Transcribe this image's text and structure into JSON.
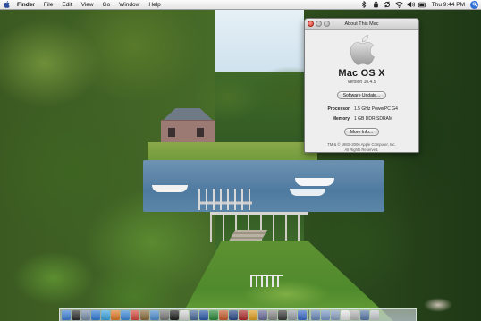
{
  "menubar": {
    "apple_symbol": "",
    "app_name": "Finder",
    "items": [
      "File",
      "Edit",
      "View",
      "Go",
      "Window",
      "Help"
    ],
    "status_icons": [
      "bluetooth-icon",
      "keychain-lock-icon",
      "sync-icon",
      "airport-wifi-icon",
      "volume-icon",
      "battery-icon"
    ],
    "clock": "Thu 9:44 PM"
  },
  "about_window": {
    "title": "About This Mac",
    "os_name": "Mac OS X",
    "version": "Version 10.4.5",
    "software_update_button": "Software Update...",
    "processor_label": "Processor",
    "processor_value": "1.5 GHz PowerPC G4",
    "memory_label": "Memory",
    "memory_value": "1 GB DDR SDRAM",
    "more_info_button": "More Info...",
    "legal_line1": "TM & © 1983–2006 Apple Computer, Inc.",
    "legal_line2": "All Rights Reserved."
  },
  "dock": {
    "items": [
      {
        "name": "finder-icon",
        "color": "#3d7fd8"
      },
      {
        "name": "dashboard-icon",
        "color": "#2b2b2b"
      },
      {
        "name": "mail-icon",
        "color": "#7a8fa8"
      },
      {
        "name": "safari-icon",
        "color": "#2f7bd6"
      },
      {
        "name": "ichat-icon",
        "color": "#3aa4e0"
      },
      {
        "name": "firefox-icon",
        "color": "#e07a22"
      },
      {
        "name": "itunes-icon",
        "color": "#3a8ad8"
      },
      {
        "name": "ical-icon",
        "color": "#d6473d"
      },
      {
        "name": "address-book-icon",
        "color": "#8a6a3a"
      },
      {
        "name": "iphoto-icon",
        "color": "#4f8fcf"
      },
      {
        "name": "system-preferences-icon",
        "color": "#7a7a7a"
      },
      {
        "name": "terminal-icon",
        "color": "#1f1f1f"
      },
      {
        "name": "textedit-icon",
        "color": "#d8d8d8"
      },
      {
        "name": "preview-icon",
        "color": "#4a6a9a"
      },
      {
        "name": "word-icon",
        "color": "#2a5aa8"
      },
      {
        "name": "excel-icon",
        "color": "#2a8a3a"
      },
      {
        "name": "powerpoint-icon",
        "color": "#c85a2a"
      },
      {
        "name": "photoshop-icon",
        "color": "#2a4a8a"
      },
      {
        "name": "acrobat-icon",
        "color": "#b02a2a"
      },
      {
        "name": "garageband-icon",
        "color": "#e0a020"
      },
      {
        "name": "imovie-icon",
        "color": "#6a6a9a"
      },
      {
        "name": "idvd-icon",
        "color": "#8a8a8a"
      },
      {
        "name": "activity-monitor-icon",
        "color": "#3a3a3a"
      },
      {
        "name": "disk-utility-icon",
        "color": "#9aa0a8"
      },
      {
        "name": "quicktime-icon",
        "color": "#3a6ac8"
      }
    ],
    "right_items": [
      {
        "name": "applications-folder-icon",
        "color": "#6a8ab8"
      },
      {
        "name": "documents-folder-icon",
        "color": "#7a9ac8"
      },
      {
        "name": "downloads-stack-icon",
        "color": "#8aa0c0"
      },
      {
        "name": "document-icon",
        "color": "#e8e8e8"
      },
      {
        "name": "minimized-window-icon",
        "color": "#b8b8b8"
      },
      {
        "name": "network-icon",
        "color": "#5a7aa8"
      },
      {
        "name": "trash-icon",
        "color": "#c8ccd0"
      }
    ]
  }
}
